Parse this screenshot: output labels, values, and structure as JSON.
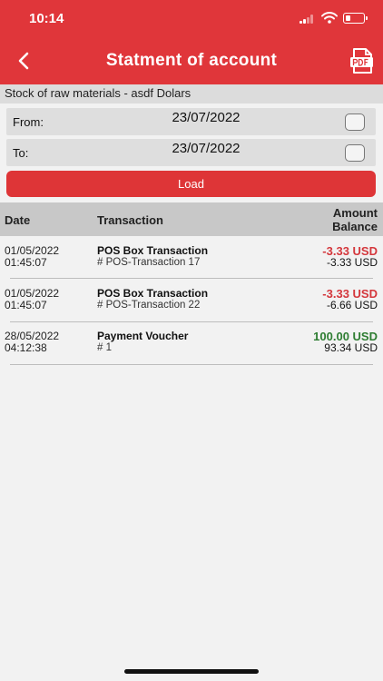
{
  "status_bar": {
    "time": "10:14"
  },
  "header": {
    "title": "Statment of account",
    "pdf_icon": "pdf-file-icon",
    "back_icon": "chevron-left-icon"
  },
  "account": {
    "label": "Stock of raw materials - asdf Dolars"
  },
  "filters": {
    "from_label": "From:",
    "from_value": "23/07/2022",
    "to_label": "To:",
    "to_value": "23/07/2022",
    "load_label": "Load"
  },
  "table": {
    "col_date": "Date",
    "col_transaction": "Transaction",
    "col_amount": "Amount",
    "col_balance": "Balance",
    "rows": [
      {
        "date": "01/05/2022",
        "time": "01:45:07",
        "name": "POS Box Transaction",
        "ref": "# POS-Transaction 17",
        "amount": "-3.33 USD",
        "balance": "-3.33 USD"
      },
      {
        "date": "01/05/2022",
        "time": "01:45:07",
        "name": "POS Box Transaction",
        "ref": "# POS-Transaction 22",
        "amount": "-3.33 USD",
        "balance": "-6.66 USD"
      },
      {
        "date": "28/05/2022",
        "time": "04:12:38",
        "name": "Payment Voucher",
        "ref": "# 1",
        "amount": "100.00 USD",
        "balance": "93.34 USD"
      }
    ]
  },
  "colors": {
    "brand": "#e0363a",
    "negative": "#d4373c",
    "positive": "#2e7d32"
  }
}
